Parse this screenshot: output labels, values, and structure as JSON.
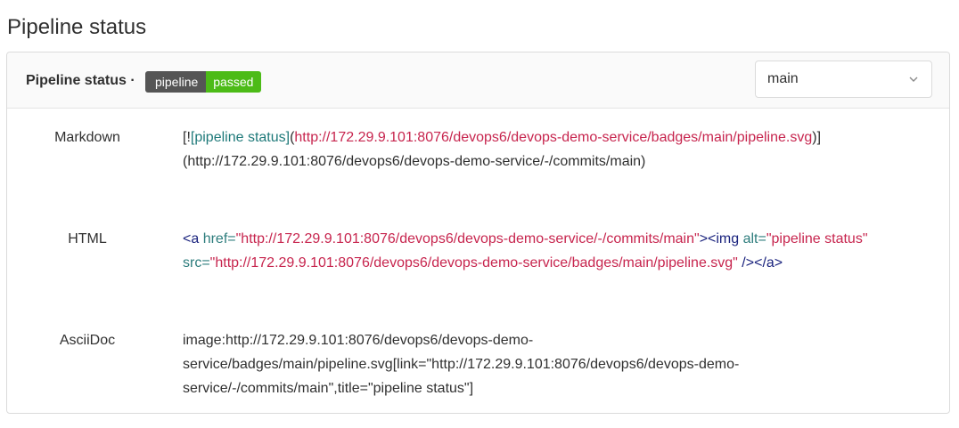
{
  "page": {
    "title": "Pipeline status"
  },
  "header": {
    "title": "Pipeline status ·",
    "badge_left": "pipeline",
    "badge_right": "passed",
    "branch": "main",
    "colors": {
      "badge_left": "#555555",
      "badge_right": "#4cbb17"
    }
  },
  "rows": {
    "markdown": {
      "label": "Markdown",
      "p1": "[!",
      "p2": "[pipeline status]",
      "p3": "(",
      "p4": "http://172.29.9.101:8076/devops6/devops-demo-service/badges/main/pipeline.svg",
      "p5": ")]",
      "p6": "(http://172.29.9.101:8076/devops6/devops-demo-service/-/commits/main)"
    },
    "html": {
      "label": "HTML",
      "t1": "<a",
      "a1": " href=",
      "s1": "\"http://172.29.9.101:8076/devops6/devops-demo-service/-/commits/main\"",
      "t2": "><img",
      "a2": " alt=",
      "s2": "\"pipeline status\"",
      "a3": " src=",
      "s3": "\"http://172.29.9.101:8076/devops6/devops-demo-service/badges/main/pipeline.svg\"",
      "t3": " /></a>"
    },
    "asciidoc": {
      "label": "AsciiDoc",
      "value": "image:http://172.29.9.101:8076/devops6/devops-demo-service/badges/main/pipeline.svg[link=\"http://172.29.9.101:8076/devops6/devops-demo-service/-/commits/main\",title=\"pipeline status\"]"
    }
  }
}
